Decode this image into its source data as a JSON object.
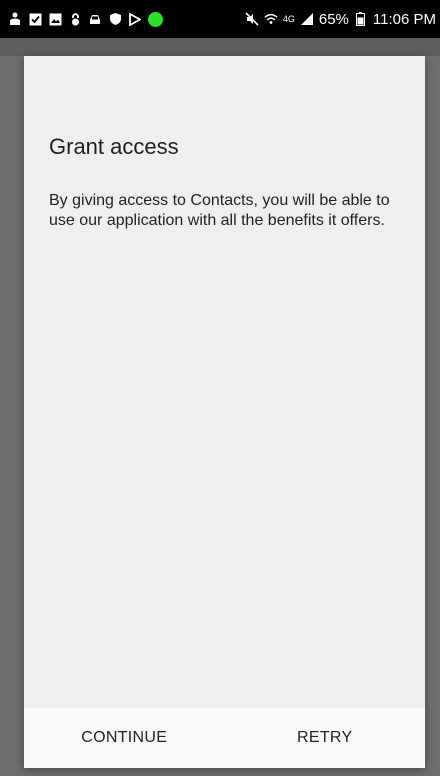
{
  "status_bar": {
    "left_icons": [
      "person-upload-icon",
      "checkbox-icon",
      "image-icon",
      "lock-icon",
      "car-icon",
      "shield-icon",
      "flag-icon",
      "green-dot-icon"
    ],
    "right_icons": [
      "mute-icon",
      "wifi-icon",
      "lte-icon",
      "signal-icon",
      "battery-icon"
    ],
    "network_label": "4G",
    "battery_percent": "65%",
    "time": "11:06 PM",
    "accent_color": "#2ee02e"
  },
  "dialog": {
    "title": "Grant access",
    "message": "By giving access to Contacts, you will be able to use our application with all the benefits it offers.",
    "continue_label": "CONTINUE",
    "retry_label": "RETRY"
  }
}
